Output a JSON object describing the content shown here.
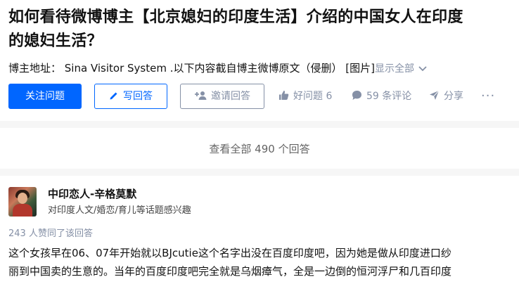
{
  "question": {
    "title_line1": "如何看待微博博主【北京媳妇的印度生活】介绍的中国女人在印度",
    "title_line2": "的媳妇生活？",
    "detail": "博主地址： Sina Visitor System .以下内容截自博主微博原文（侵删） [图片]",
    "show_all": "显示全部"
  },
  "actions": {
    "follow_label": "关注问题",
    "write_label": "写回答",
    "invite_label": "邀请回答",
    "good_question_label": "好问题 6",
    "comments_label": "59 条评论",
    "share_label": "分享",
    "more_label": "···"
  },
  "view_all_answers": "查看全部 490 个回答",
  "answer": {
    "author_name": "中印恋人-辛格莫默",
    "author_headline": "对印度人文/婚恋/育儿等话题感兴趣",
    "vote_summary": "243 人赞同了该回答",
    "text_line1": "这个女孩早在06、07年开始就以BJcutie这个名字出没在百度印度吧，因为她是做从印度进口纱",
    "text_line2": "丽到中国卖的生意的。当年的百度印度吧完全就是乌烟瘴气，全是一边倒的恒河浮尸和几百印度"
  },
  "colors": {
    "brand_blue": "#0066ff",
    "muted_gray": "#8590a6",
    "band_gray": "#f6f6f6"
  },
  "icons": [
    "chevron-down-icon",
    "pencil-icon",
    "add-user-icon",
    "thumbs-up-icon",
    "comment-bubble-icon",
    "paper-plane-icon",
    "more-dots-icon"
  ]
}
